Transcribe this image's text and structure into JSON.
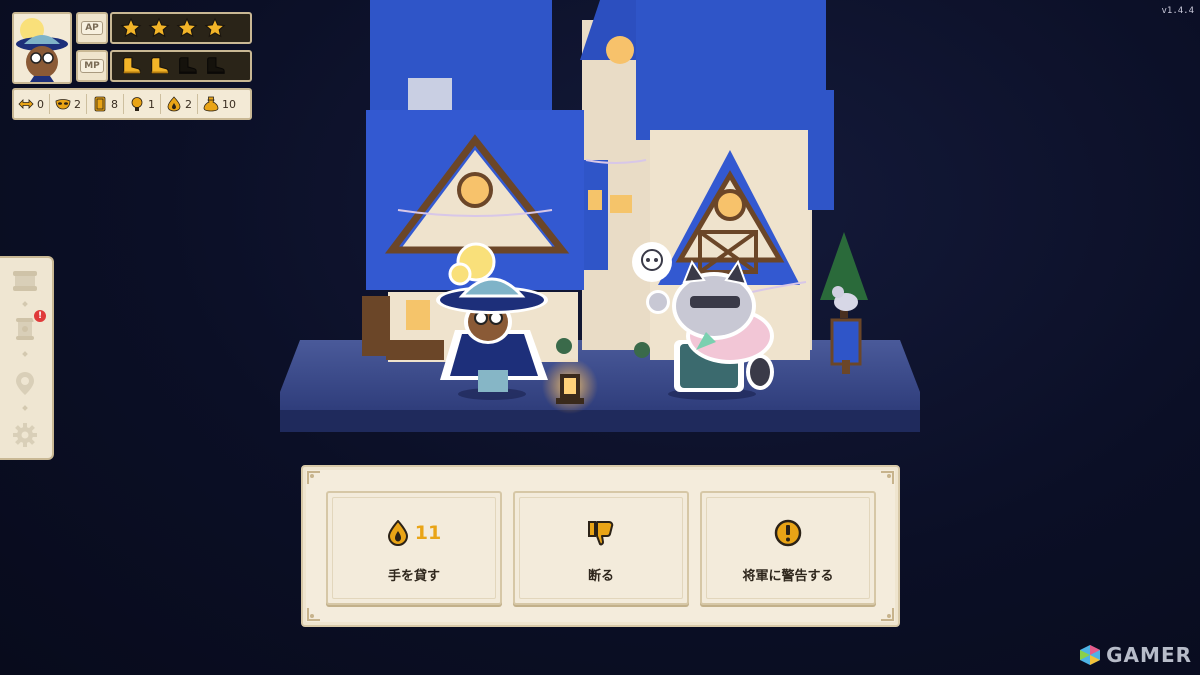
{
  "version": "v1.4.4",
  "hud": {
    "ap_label": "AP",
    "mp_label": "MP",
    "ap": {
      "filled": 4,
      "total": 4
    },
    "mp": {
      "filled": 2,
      "total": 4
    },
    "resources": [
      {
        "icon": "arrows-icon",
        "value": "0"
      },
      {
        "icon": "mask-icon",
        "value": "2"
      },
      {
        "icon": "cards-icon",
        "value": "8"
      },
      {
        "icon": "lightbulb-icon",
        "value": "1"
      },
      {
        "icon": "fire-drop-icon",
        "value": "2"
      },
      {
        "icon": "money-bag-icon",
        "value": "10"
      }
    ]
  },
  "side_menu": {
    "items": [
      {
        "icon": "map-scroll-icon",
        "badge": false
      },
      {
        "icon": "quest-scroll-icon",
        "badge": true,
        "badge_text": "!"
      },
      {
        "icon": "location-pin-icon",
        "badge": false
      },
      {
        "icon": "gear-icon",
        "badge": false
      }
    ]
  },
  "choices": [
    {
      "icon": "fire-drop-icon",
      "cost": "11",
      "label": "手を貸す"
    },
    {
      "icon": "thumbs-down-icon",
      "cost": "",
      "label": "断る"
    },
    {
      "icon": "exclamation-icon",
      "cost": "",
      "label": "将軍に警告する"
    }
  ],
  "watermark": {
    "text": "GAMER"
  },
  "colors": {
    "accent_gold": "#e9a416",
    "panel_bg": "#f4ecdc",
    "roof_blue": "#2f55c8",
    "night_bg": "#0b0f26",
    "badge_red": "#e03a3a"
  }
}
